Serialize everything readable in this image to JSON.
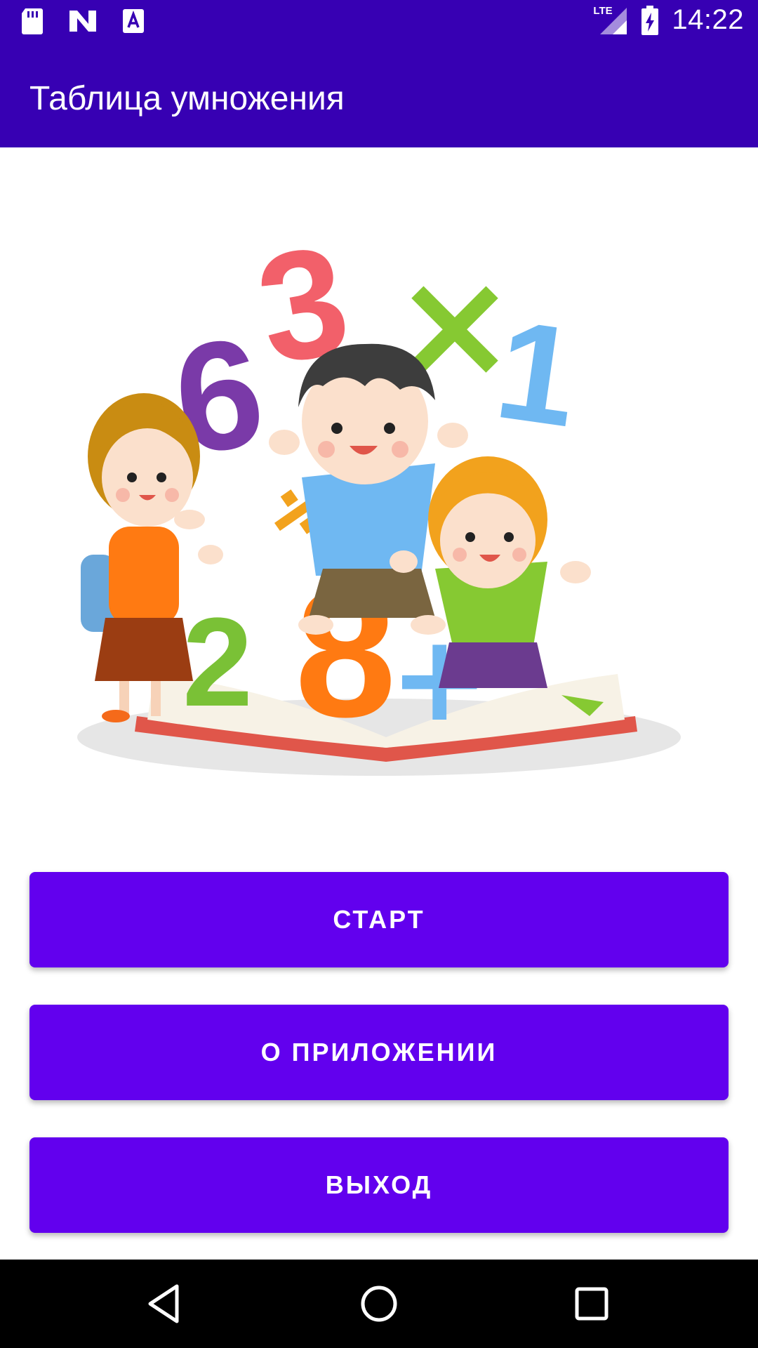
{
  "status_bar": {
    "left_icons": [
      "sd-card-icon",
      "n-logo-icon",
      "a-text-icon"
    ],
    "network_label": "LTE",
    "time": "14:22"
  },
  "app_bar": {
    "title": "Таблица умножения"
  },
  "illustration": {
    "subject": "kids-math-illustration",
    "digits": [
      "3",
      "6",
      "1",
      "2",
      "8"
    ],
    "symbols": [
      "×",
      "÷",
      "+"
    ]
  },
  "buttons": {
    "start": "СТАРТ",
    "about": "О ПРИЛОЖЕНИИ",
    "exit": "ВЫХОД"
  },
  "nav_bar": {
    "icons": [
      "back-icon",
      "home-icon",
      "recents-icon"
    ]
  },
  "colors": {
    "primary_dark": "#3700B3",
    "primary": "#6200EE"
  }
}
